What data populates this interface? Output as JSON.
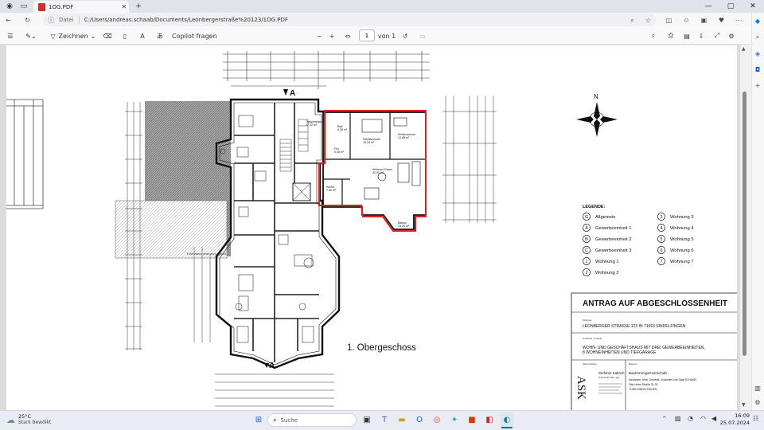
{
  "browser": {
    "tab_title": "1OG.PDF",
    "address_label": "Datei",
    "url": "C:/Users/andreas.schaab/Documents/Leonbergerstraße%20123/1OG.PDF"
  },
  "pdf_toolbar": {
    "draw_label": "Zeichnen",
    "copilot_label": "Copilot fragen",
    "page_current": "1",
    "page_total_label": "von 1"
  },
  "drawing": {
    "floor_label": "1. Obergeschoss",
    "compass_north": "N",
    "section_marker": "A",
    "legend_title": "LEGENDE:",
    "legend": [
      {
        "sym": "G",
        "label": "Allgemein"
      },
      {
        "sym": "A",
        "label": "Gewerbeeinheit 1"
      },
      {
        "sym": "B",
        "label": "Gewerbeeinheit 2"
      },
      {
        "sym": "C",
        "label": "Gewerbeeinheit 3"
      },
      {
        "sym": "1",
        "label": "Wohnung 1"
      },
      {
        "sym": "2",
        "label": "Wohnung 2"
      },
      {
        "sym": "3",
        "label": "Wohnung 3"
      },
      {
        "sym": "4",
        "label": "Wohnung 4"
      },
      {
        "sym": "5",
        "label": "Wohnung 5"
      },
      {
        "sym": "6",
        "label": "Wohnung 6"
      },
      {
        "sym": "7",
        "label": "Wohnung 7"
      }
    ],
    "title_block": {
      "heading": "ANTRAG AUF ABGESCHLOSSENHEIT",
      "standort_label": "Standort",
      "address": "LEONBERGER STRASSE 123 IN 71063 SINDELFINGEN",
      "project_label": "Gebäude / Projekt",
      "project_line1": "WOHN- UND GESCHÄFTSHAUS MIT DREI GEWERBEEINHEITEN,",
      "project_line2": "8 WOHNEINHEITEN UND TIEFGARAGE",
      "planverfasser_label": "Planverfasser",
      "bauherr_label": "Bauherr",
      "logo": "ASK",
      "architect_name": "Stefanie Kallach",
      "architect_sub": "Architektin Dipl.-Ing.",
      "bauherr_name": "Bauherrengemeinschaft",
      "bauherr_names": "Alexander, Alois, Andreas, Johannes und Olga SCHAAB",
      "bauherr_street": "Otto-Hahn-Straße 31-33",
      "bauherr_city": "71069 SINDELFINGEN"
    },
    "rooms": [
      {
        "name": "Schlafzimmer",
        "area": "15,33 m²"
      },
      {
        "name": "Kinderzimmer",
        "area": "14,88 m²"
      },
      {
        "name": "Bad",
        "area": "6,26 m²"
      },
      {
        "name": "Flur",
        "area": "9,45 m²"
      },
      {
        "name": "Wohnen/ Essen",
        "area": "42,90 m²"
      },
      {
        "name": "Küche",
        "area": "7,60 m²"
      },
      {
        "name": "Balkon",
        "area": "14,25 m²"
      },
      {
        "name": "Treppenhaus",
        "area": "17,32 m²"
      }
    ]
  },
  "taskbar": {
    "weather_temp": "25°C",
    "weather_desc": "Stark bewölkt",
    "search_placeholder": "Suche",
    "time": "16:09",
    "date": "25.07.2024"
  },
  "colors": {
    "highlight": "#e02020",
    "hatch": "#7a7a7a"
  }
}
